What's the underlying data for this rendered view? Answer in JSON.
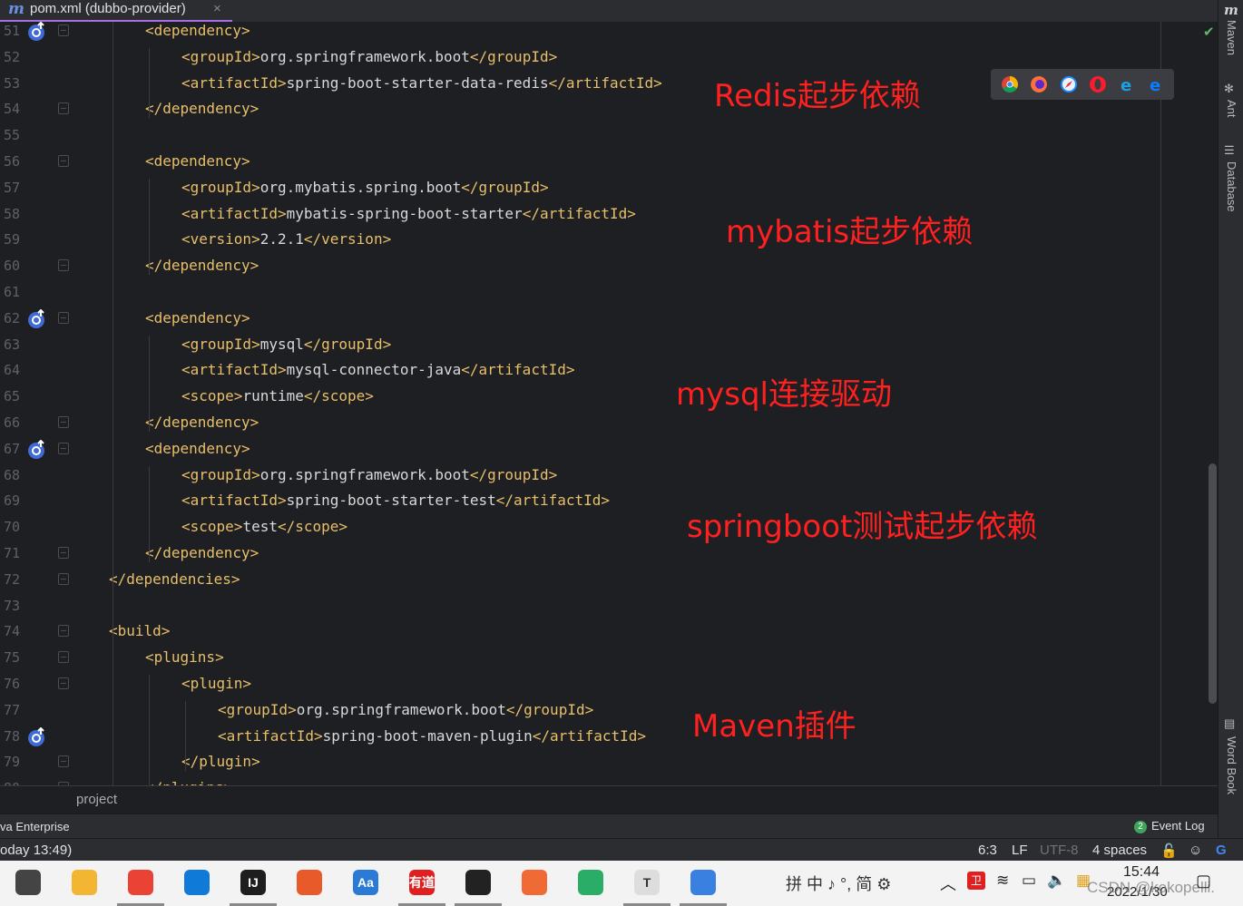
{
  "tab": {
    "label": "pom.xml (dubbo-provider)",
    "close": "×",
    "icon_letter": "m"
  },
  "lines": [
    {
      "num": "51",
      "indent": 1,
      "segments": [
        {
          "t": "tag",
          "v": "<dependency>"
        }
      ],
      "run": true
    },
    {
      "num": "52",
      "indent": 2,
      "segments": [
        {
          "t": "tag",
          "v": "<groupId>"
        },
        {
          "t": "txt",
          "v": "org.springframework.boot"
        },
        {
          "t": "tag",
          "v": "</groupId>"
        }
      ]
    },
    {
      "num": "53",
      "indent": 2,
      "segments": [
        {
          "t": "tag",
          "v": "<artifactId>"
        },
        {
          "t": "txt",
          "v": "spring-boot-starter-data-redis"
        },
        {
          "t": "tag",
          "v": "</artifactId>"
        }
      ]
    },
    {
      "num": "54",
      "indent": 1,
      "segments": [
        {
          "t": "tag",
          "v": "</dependency>"
        }
      ]
    },
    {
      "num": "55",
      "indent": 0,
      "segments": []
    },
    {
      "num": "56",
      "indent": 1,
      "segments": [
        {
          "t": "tag",
          "v": "<dependency>"
        }
      ]
    },
    {
      "num": "57",
      "indent": 2,
      "segments": [
        {
          "t": "tag",
          "v": "<groupId>"
        },
        {
          "t": "txt",
          "v": "org.mybatis.spring.boot"
        },
        {
          "t": "tag",
          "v": "</groupId>"
        }
      ]
    },
    {
      "num": "58",
      "indent": 2,
      "segments": [
        {
          "t": "tag",
          "v": "<artifactId>"
        },
        {
          "t": "txt",
          "v": "mybatis-spring-boot-starter"
        },
        {
          "t": "tag",
          "v": "</artifactId>"
        }
      ]
    },
    {
      "num": "59",
      "indent": 2,
      "segments": [
        {
          "t": "tag",
          "v": "<version>"
        },
        {
          "t": "txt",
          "v": "2.2.1"
        },
        {
          "t": "tag",
          "v": "</version>"
        }
      ]
    },
    {
      "num": "60",
      "indent": 1,
      "segments": [
        {
          "t": "tag",
          "v": "</dependency>"
        }
      ]
    },
    {
      "num": "61",
      "indent": 0,
      "segments": []
    },
    {
      "num": "62",
      "indent": 1,
      "segments": [
        {
          "t": "tag",
          "v": "<dependency>"
        }
      ],
      "run": true
    },
    {
      "num": "63",
      "indent": 2,
      "segments": [
        {
          "t": "tag",
          "v": "<groupId>"
        },
        {
          "t": "txt",
          "v": "mysql"
        },
        {
          "t": "tag",
          "v": "</groupId>"
        }
      ]
    },
    {
      "num": "64",
      "indent": 2,
      "segments": [
        {
          "t": "tag",
          "v": "<artifactId>"
        },
        {
          "t": "txt",
          "v": "mysql-connector-java"
        },
        {
          "t": "tag",
          "v": "</artifactId>"
        }
      ]
    },
    {
      "num": "65",
      "indent": 2,
      "segments": [
        {
          "t": "tag",
          "v": "<scope>"
        },
        {
          "t": "txt",
          "v": "runtime"
        },
        {
          "t": "tag",
          "v": "</scope>"
        }
      ]
    },
    {
      "num": "66",
      "indent": 1,
      "segments": [
        {
          "t": "tag",
          "v": "</dependency>"
        }
      ]
    },
    {
      "num": "67",
      "indent": 1,
      "segments": [
        {
          "t": "tag",
          "v": "<dependency>"
        }
      ],
      "run": true
    },
    {
      "num": "68",
      "indent": 2,
      "segments": [
        {
          "t": "tag",
          "v": "<groupId>"
        },
        {
          "t": "txt",
          "v": "org.springframework.boot"
        },
        {
          "t": "tag",
          "v": "</groupId>"
        }
      ]
    },
    {
      "num": "69",
      "indent": 2,
      "segments": [
        {
          "t": "tag",
          "v": "<artifactId>"
        },
        {
          "t": "txt",
          "v": "spring-boot-starter-test"
        },
        {
          "t": "tag",
          "v": "</artifactId>"
        }
      ]
    },
    {
      "num": "70",
      "indent": 2,
      "segments": [
        {
          "t": "tag",
          "v": "<scope>"
        },
        {
          "t": "txt",
          "v": "test"
        },
        {
          "t": "tag",
          "v": "</scope>"
        }
      ]
    },
    {
      "num": "71",
      "indent": 1,
      "segments": [
        {
          "t": "tag",
          "v": "</dependency>"
        }
      ]
    },
    {
      "num": "72",
      "indent": 0,
      "segments": [
        {
          "t": "tag",
          "v": "</dependencies>"
        }
      ]
    },
    {
      "num": "73",
      "indent": 0,
      "segments": []
    },
    {
      "num": "74",
      "indent": 0,
      "segments": [
        {
          "t": "tag",
          "v": "<build>"
        }
      ]
    },
    {
      "num": "75",
      "indent": 1,
      "segments": [
        {
          "t": "tag",
          "v": "<plugins>"
        }
      ]
    },
    {
      "num": "76",
      "indent": 2,
      "segments": [
        {
          "t": "tag",
          "v": "<plugin>"
        }
      ]
    },
    {
      "num": "77",
      "indent": 3,
      "segments": [
        {
          "t": "tag",
          "v": "<groupId>"
        },
        {
          "t": "txt",
          "v": "org.springframework.boot"
        },
        {
          "t": "tag",
          "v": "</groupId>"
        }
      ]
    },
    {
      "num": "78",
      "indent": 3,
      "segments": [
        {
          "t": "tag",
          "v": "<artifactId>"
        },
        {
          "t": "txt",
          "v": "spring-boot-maven-plugin"
        },
        {
          "t": "tag",
          "v": "</artifactId>"
        }
      ],
      "run": true
    },
    {
      "num": "79",
      "indent": 2,
      "segments": [
        {
          "t": "tag",
          "v": "</plugin>"
        }
      ]
    },
    {
      "num": "80",
      "indent": 1,
      "segments": [
        {
          "t": "tag",
          "v": "</plugins>"
        }
      ]
    }
  ],
  "annotations": {
    "redis": "Redis起步依赖",
    "mybatis": "mybatis起步依赖",
    "mysql": "mysql连接驱动",
    "springboot_test": "springboot测试起步依赖",
    "maven_plugin": "Maven插件"
  },
  "browser_icons": [
    "chrome-icon",
    "firefox-icon",
    "safari-icon",
    "opera-icon",
    "ie-icon",
    "edge-icon"
  ],
  "right_rail": {
    "maven": "Maven",
    "ant": "Ant",
    "database": "Database",
    "word_book": "Word Book"
  },
  "breadcrumb": "project",
  "toolstrip": {
    "left": "va Enterprise",
    "event_count": "2",
    "event_log": "Event Log"
  },
  "status": {
    "left": "oday 13:49)",
    "position": "6:3",
    "line_sep": "LF",
    "encoding": "UTF-8",
    "indent": "4 spaces"
  },
  "taskbar": {
    "apps": [
      {
        "name": "task-view",
        "label": ""
      },
      {
        "name": "file-explorer",
        "label": ""
      },
      {
        "name": "chrome",
        "label": ""
      },
      {
        "name": "edge",
        "label": ""
      },
      {
        "name": "intellij",
        "label": "IJ"
      },
      {
        "name": "spiral-app",
        "label": ""
      },
      {
        "name": "dictionary",
        "label": "Aa"
      },
      {
        "name": "youdao",
        "label": "有道"
      },
      {
        "name": "panda-app",
        "label": ""
      },
      {
        "name": "compass-app",
        "label": ""
      },
      {
        "name": "wechat",
        "label": ""
      },
      {
        "name": "typora",
        "label": "T"
      },
      {
        "name": "rings-app",
        "label": ""
      }
    ],
    "ime": "拼 中 ♪ °, 简 ⚙",
    "time": "15:44",
    "date": "2022/1/30",
    "watermark": "CSDN @kokopelli."
  },
  "colors": {
    "tag": "#e8bf6a",
    "annotation": "#ff2020",
    "accent": "#a66ee0"
  }
}
